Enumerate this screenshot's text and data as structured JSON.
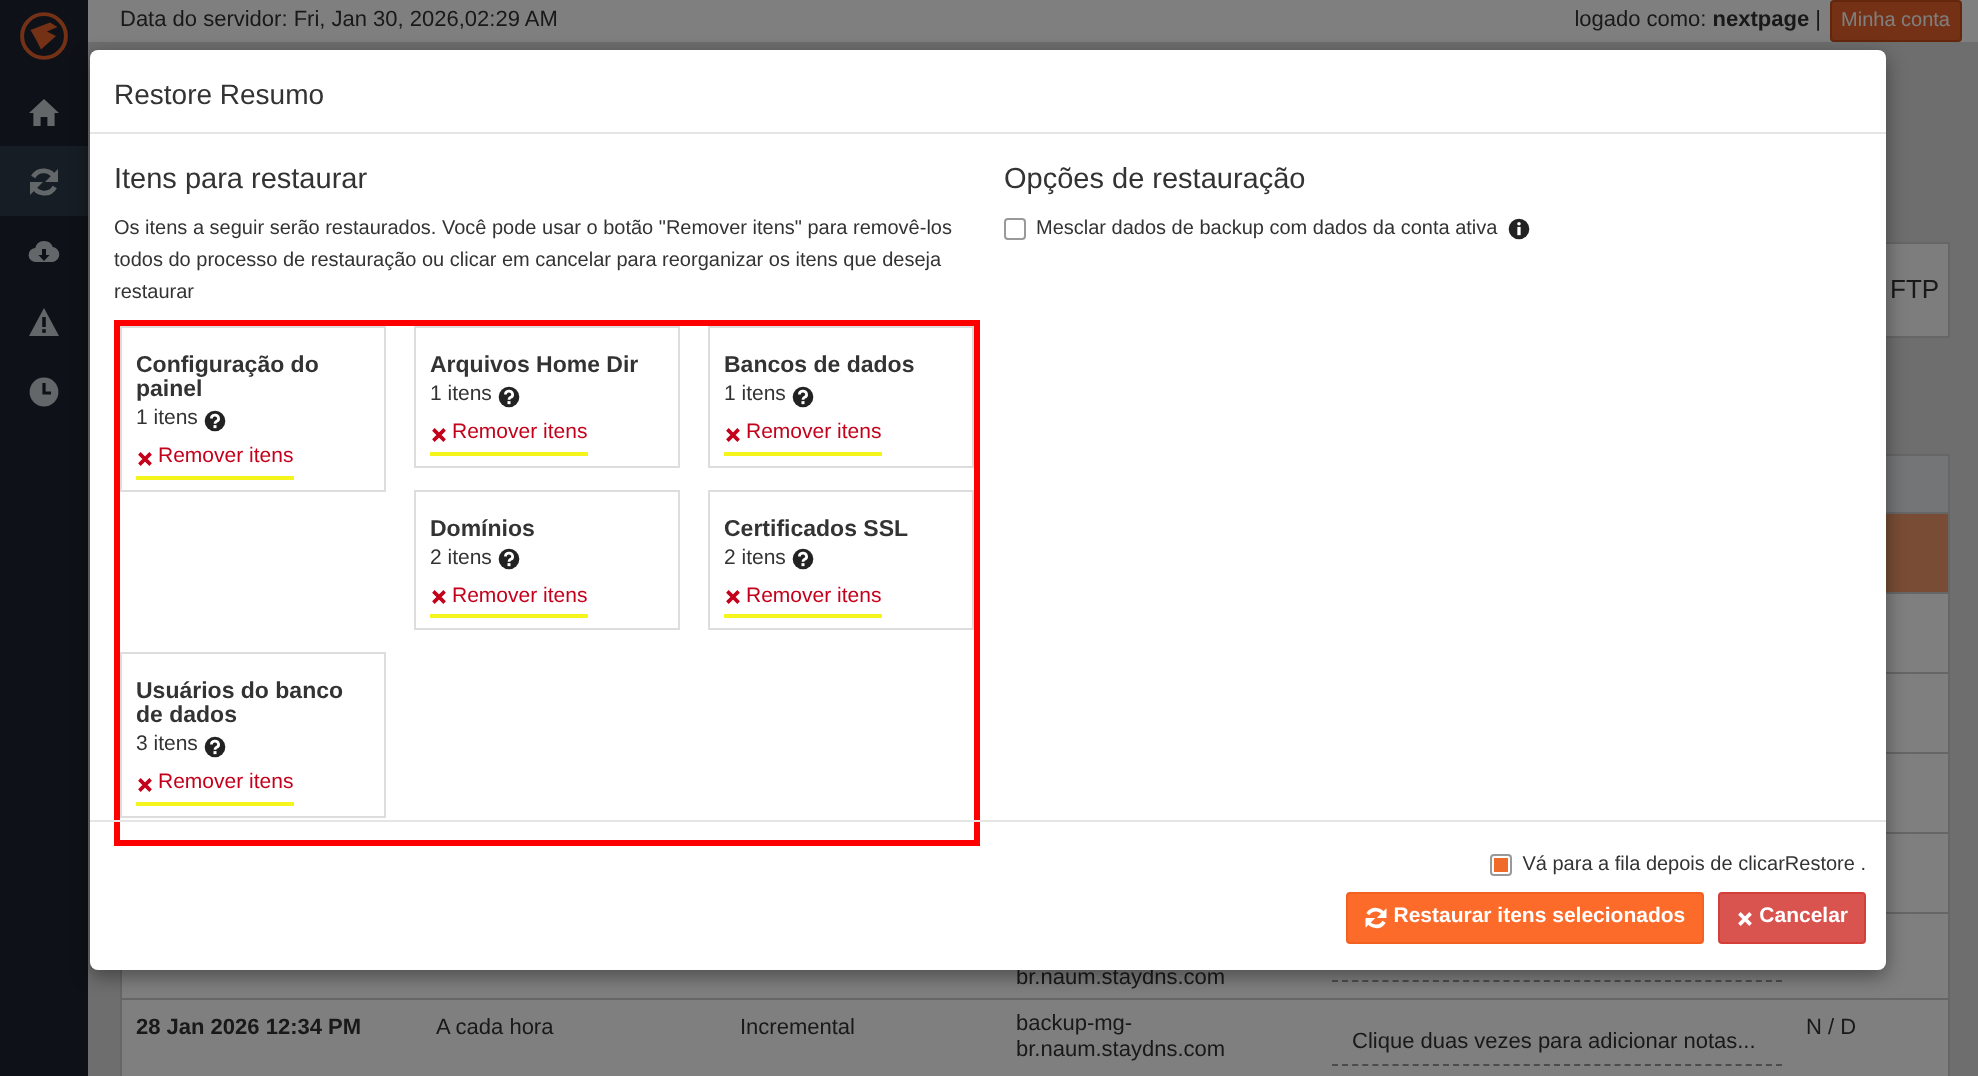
{
  "sidebar": {
    "items": [
      {
        "kind": "home",
        "selected": false
      },
      {
        "kind": "refresh",
        "selected": true
      },
      {
        "kind": "cloud-download",
        "selected": false
      },
      {
        "kind": "warning",
        "selected": false
      },
      {
        "kind": "clock",
        "selected": false
      }
    ]
  },
  "top_bar": {
    "server_time": "Data do servidor: Fri, Jan 30, 2026,02:29 AM",
    "logged_in": "logado como: **nextpage** |",
    "account_button": "Minha conta"
  },
  "background_table": {
    "tab": "FTP",
    "rows": [
      {
        "selected": true
      },
      {
        "selected": false
      },
      {
        "selected": false
      },
      {
        "selected": false
      },
      {
        "selected": false
      },
      {
        "selected": false,
        "hostname": "br.naum.staydns.com"
      },
      {
        "selected": false,
        "date": "28 Jan 2026 12:34 PM",
        "frequency": "A cada hora",
        "type": "Incremental",
        "hostname": "backup-mg-br.naum.staydns.com",
        "notes": "Clique duas vezes para adicionar notas...",
        "status": "N / D"
      }
    ]
  },
  "dialog": {
    "title": "Restore Resumo",
    "items_section": {
      "heading": "Itens para restaurar",
      "description": "Os itens a seguir serão restaurados. Você pode usar o botão \"Remover itens\" para removê-los todos do processo de restauração ou clicar em cancelar para reorganizar os itens que deseja restaurar",
      "items": [
        {
          "title": "Configuração do painel",
          "count": "1 itens",
          "remove": "Remover itens"
        },
        {
          "title": "Arquivos Home Dir",
          "count": "1 itens",
          "remove": "Remover itens"
        },
        {
          "title": "Bancos de dados",
          "count": "1 itens",
          "remove": "Remover itens"
        },
        {
          "title": "Domínios",
          "count": "2 itens",
          "remove": "Remover itens"
        },
        {
          "title": "Certificados SSL",
          "count": "2 itens",
          "remove": "Remover itens"
        },
        {
          "title": "Usuários do banco de dados",
          "count": "3 itens",
          "remove": "Remover itens"
        }
      ]
    },
    "options_section": {
      "heading": "Opções de restauração",
      "merge_option": {
        "label": "Mesclar dados de backup com dados da conta ativa",
        "checked": false
      }
    },
    "queue_option": {
      "label": "Vá para a fila depois de clicarRestore .",
      "checked": true
    },
    "buttons": [
      {
        "kind": "restore",
        "label": "Restaurar itens selecionados"
      },
      {
        "kind": "cancel",
        "label": "Cancelar"
      }
    ]
  }
}
